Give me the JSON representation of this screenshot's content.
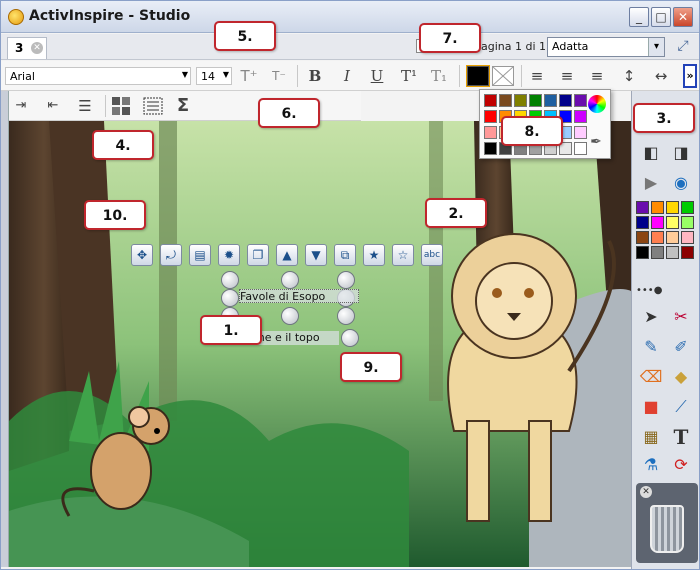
{
  "window": {
    "title": "ActivInspire - Studio"
  },
  "tabs": [
    {
      "label": "3"
    }
  ],
  "page": {
    "counter": "agina 1 di 1",
    "zoom": "Adatta"
  },
  "format": {
    "font": "Arial",
    "size": "14"
  },
  "icons": {
    "grow": "T⁺",
    "shrink": "T⁻",
    "bold": "B",
    "italic": "I",
    "underline": "U",
    "superscript": "T¹",
    "subscript": "T₁",
    "sigma": "Σ",
    "more": "»",
    "indent": "⇥",
    "outdent": "⇤",
    "bullets": "☰",
    "align_left": "≡",
    "align_center": "≡",
    "align_right": "≡",
    "spacing": "↕",
    "spacing2": "↔"
  },
  "palette": {
    "colors": [
      "#c00000",
      "#7a4a1f",
      "#7f7f00",
      "#008000",
      "#1f5fa0",
      "#00008b",
      "#6a0dad",
      "#ff0000",
      "#ff8c00",
      "#ffd700",
      "#00cc00",
      "#00bfff",
      "#0000ff",
      "#cc00ff",
      "#ff9999",
      "#ffcc99",
      "#ffff99",
      "#ccffcc",
      "#ccffff",
      "#99ccff",
      "#ffccff",
      "#000000",
      "#404040",
      "#808080",
      "#a0a0a0",
      "#d0d0d0",
      "#e8e8e8",
      "#ffffff"
    ]
  },
  "canvas": {
    "text_title": "Favole di Esopo",
    "text_story": "one e il topo"
  },
  "right_panel": {
    "swatches": [
      "#6a0dad",
      "#ff8c00",
      "#ffd700",
      "#00cc00",
      "#00008b",
      "#ff00ff",
      "#ffff66",
      "#99ff66",
      "#8b4513",
      "#ff7f50",
      "#ffcc99",
      "#ffb6c1",
      "#000000",
      "#808080",
      "#c0c0c0",
      "#8b0000"
    ]
  },
  "callouts": [
    {
      "label": "1."
    },
    {
      "label": "2."
    },
    {
      "label": "3."
    },
    {
      "label": "4."
    },
    {
      "label": "5."
    },
    {
      "label": "6."
    },
    {
      "label": "7."
    },
    {
      "label": "8."
    },
    {
      "label": "9."
    },
    {
      "label": "10."
    }
  ]
}
